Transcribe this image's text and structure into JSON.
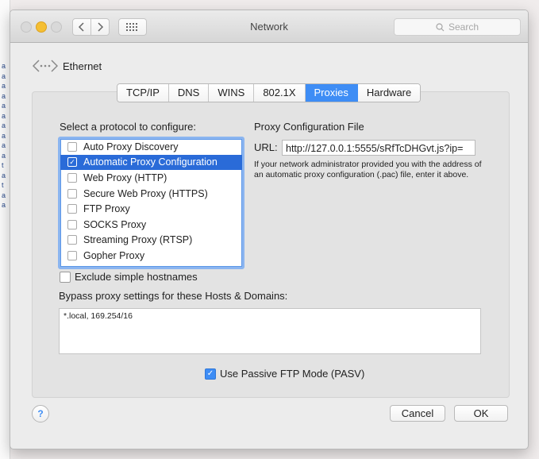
{
  "window": {
    "title": "Network",
    "search_placeholder": "Search"
  },
  "interface": {
    "name": "Ethernet"
  },
  "tabs": [
    {
      "label": "TCP/IP",
      "active": false
    },
    {
      "label": "DNS",
      "active": false
    },
    {
      "label": "WINS",
      "active": false
    },
    {
      "label": "802.1X",
      "active": false
    },
    {
      "label": "Proxies",
      "active": true
    },
    {
      "label": "Hardware",
      "active": false
    }
  ],
  "proxies": {
    "protocol_heading": "Select a protocol to configure:",
    "protocols": [
      {
        "label": "Auto Proxy Discovery",
        "checked": false,
        "selected": false
      },
      {
        "label": "Automatic Proxy Configuration",
        "checked": true,
        "selected": true
      },
      {
        "label": "Web Proxy (HTTP)",
        "checked": false,
        "selected": false
      },
      {
        "label": "Secure Web Proxy (HTTPS)",
        "checked": false,
        "selected": false
      },
      {
        "label": "FTP Proxy",
        "checked": false,
        "selected": false
      },
      {
        "label": "SOCKS Proxy",
        "checked": false,
        "selected": false
      },
      {
        "label": "Streaming Proxy (RTSP)",
        "checked": false,
        "selected": false
      },
      {
        "label": "Gopher Proxy",
        "checked": false,
        "selected": false
      }
    ],
    "config_file_heading": "Proxy Configuration File",
    "url_label": "URL:",
    "url_value": "http://127.0.0.1:5555/sRfTcDHGvt.js?ip=",
    "help_text": "If your network administrator provided you with the address of an automatic proxy configuration (.pac) file, enter it above.",
    "exclude_simple_label": "Exclude simple hostnames",
    "exclude_simple_checked": false,
    "bypass_heading": "Bypass proxy settings for these Hosts & Domains:",
    "bypass_value": "*.local, 169.254/16",
    "passive_ftp_label": "Use Passive FTP Mode (PASV)",
    "passive_ftp_checked": true
  },
  "footer": {
    "help_label": "?",
    "cancel_label": "Cancel",
    "ok_label": "OK"
  },
  "colors": {
    "accent": "#3e8df5",
    "selection": "#2a6bd8"
  },
  "desktop_fragments": [
    "a",
    "a",
    "a",
    "a",
    "a",
    "a",
    "a",
    "a",
    "a",
    "a",
    "t",
    "a",
    "t",
    "a",
    "a"
  ]
}
